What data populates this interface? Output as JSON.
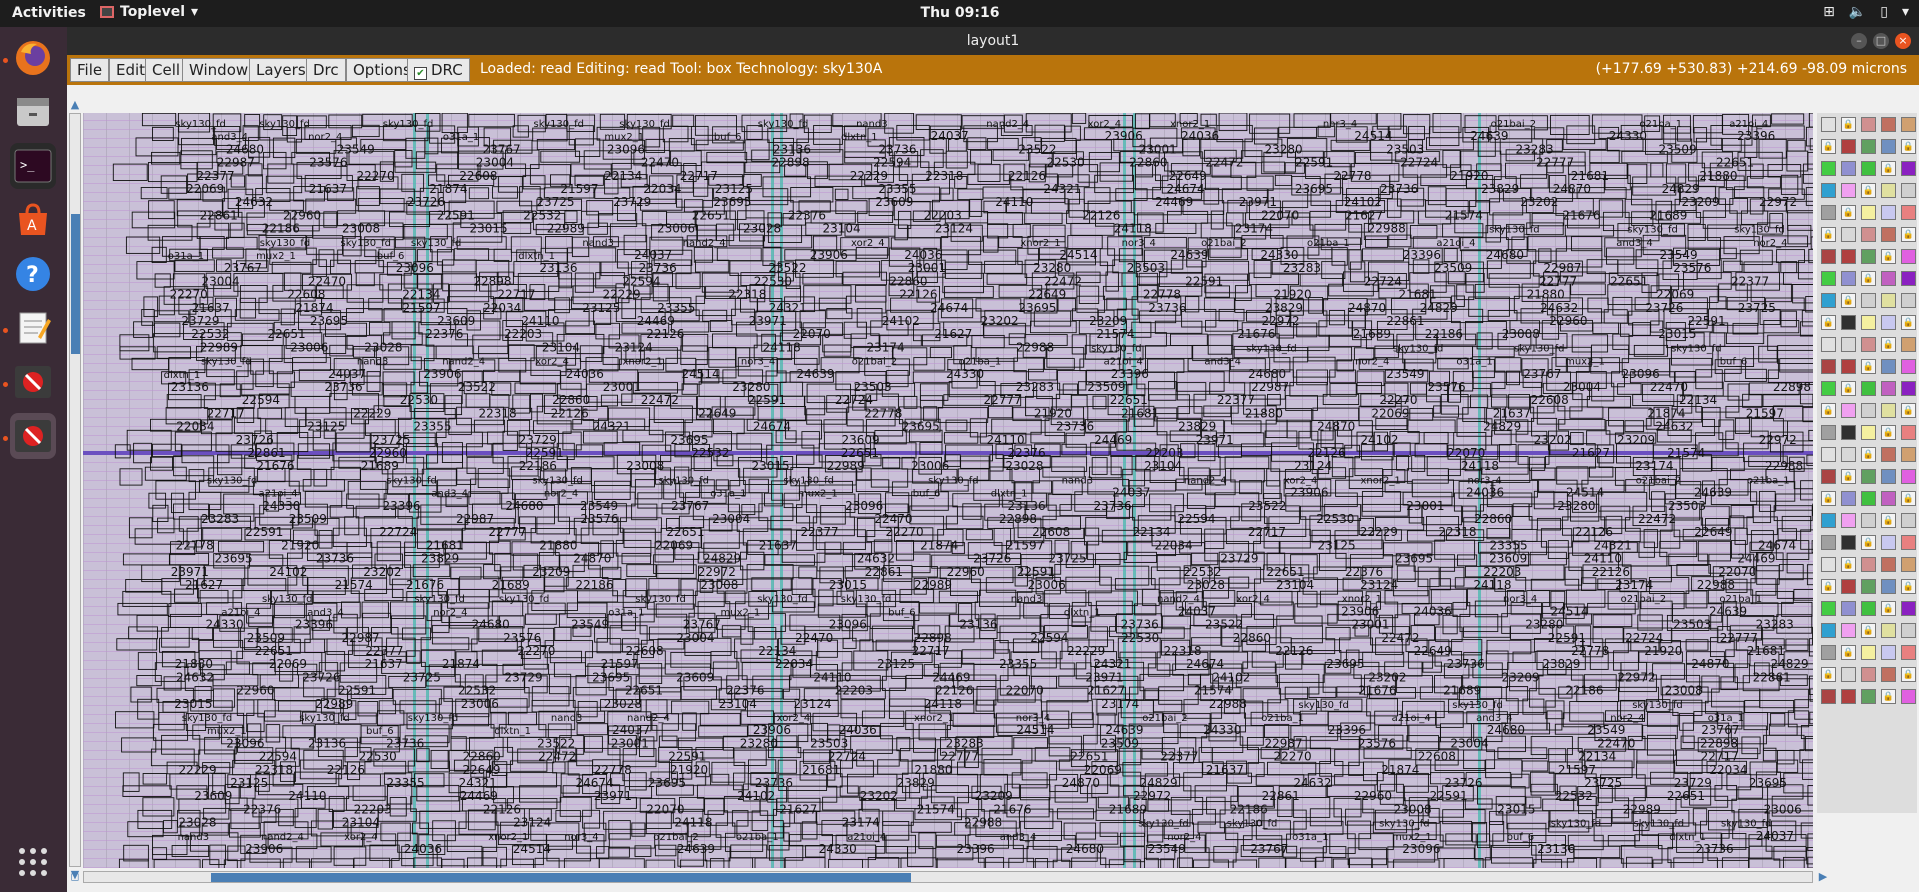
{
  "topbar": {
    "activities": "Activities",
    "app_name": "Toplevel",
    "clock": "Thu 09:16"
  },
  "dock": {
    "items": [
      {
        "name": "firefox-icon"
      },
      {
        "name": "files-icon"
      },
      {
        "name": "terminal-icon"
      },
      {
        "name": "software-center-icon"
      },
      {
        "name": "help-icon"
      },
      {
        "name": "text-editor-icon"
      },
      {
        "name": "stop-icon"
      },
      {
        "name": "stop-icon"
      }
    ]
  },
  "window": {
    "title": "layout1"
  },
  "menubar": {
    "items": [
      "File",
      "Edit",
      "Cell",
      "Window",
      "Layers",
      "Drc",
      "Options"
    ],
    "drc_label": "DRC",
    "drc_checked": true,
    "status": "Loaded: read Editing: read Tool: box  Technology: sky130A",
    "coords": "(+177.69 +530.83) +214.69 -98.09 microns"
  },
  "layout": {
    "labels": [
      "sky130_fd",
      "sky130_fd",
      "sky130_fd",
      "sky130_fd",
      "sky130_fd",
      "sky130_fd",
      "nand3",
      "nand2_4",
      "xor2_4",
      "xnor2_1",
      "nor3_4",
      "o21bai_2",
      "o21ba_1",
      "a21oi_4",
      "and3_4",
      "nor2_4",
      "o31a_1",
      "mux2_1",
      "buf_6",
      "dlxtn_1",
      "24037",
      "23906",
      "24036",
      "24514",
      "24639",
      "24330",
      "23396",
      "24680",
      "23549",
      "23767",
      "23096",
      "23136",
      "23736",
      "23522",
      "23001",
      "23280",
      "23503",
      "23283",
      "23509",
      "22987",
      "23576",
      "23004",
      "22470",
      "22898",
      "22594",
      "22530",
      "22860",
      "22472",
      "22591",
      "22724",
      "22777",
      "22651",
      "22377",
      "22270",
      "22608",
      "22134",
      "22717",
      "22229",
      "22318",
      "22126",
      "22649",
      "22778",
      "21920",
      "21681",
      "21880",
      "22069",
      "21637",
      "21874",
      "21597",
      "22034",
      "23125",
      "23355",
      "24321",
      "24674",
      "23695",
      "23736",
      "23829",
      "24870",
      "24829",
      "24632",
      "23726",
      "23725",
      "23729",
      "23695",
      "23609",
      "24110",
      "24469",
      "23971",
      "24102",
      "23202",
      "23209",
      "22972",
      "22861",
      "22960",
      "22591",
      "22532",
      "22651",
      "22376",
      "22203",
      "22126",
      "22070",
      "21627",
      "21574",
      "21676",
      "21689",
      "22186",
      "23008",
      "23015",
      "22989",
      "23006",
      "23028",
      "23104",
      "23124",
      "24118",
      "23174",
      "22988"
    ]
  }
}
